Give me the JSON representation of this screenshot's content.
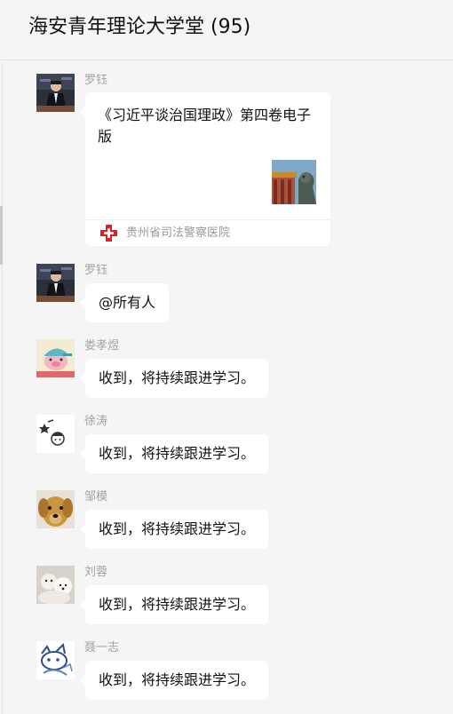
{
  "header": {
    "title": "海安青年理论大学堂 (95)"
  },
  "messages": [
    {
      "sender": "罗钰",
      "type": "link-card",
      "card": {
        "title": "《习近平谈治国理政》第四卷电子版",
        "source": "贵州省司法警察医院",
        "thumbnail": "palace-lion-thumbnail",
        "source_icon": "red-cross-icon"
      }
    },
    {
      "sender": "罗钰",
      "type": "text",
      "text": "@所有人"
    },
    {
      "sender": "娄孝煜",
      "type": "text",
      "text": "收到，将持续跟进学习。"
    },
    {
      "sender": "徐涛",
      "type": "text",
      "text": "收到，将持续跟进学习。"
    },
    {
      "sender": "邹模",
      "type": "text",
      "text": "收到，将持续跟进学习。"
    },
    {
      "sender": "刘蓉",
      "type": "text",
      "text": "收到，将持续跟进学习。"
    },
    {
      "sender": "聂一志",
      "type": "text",
      "text": "收到，将持续跟进学习。"
    }
  ],
  "colors": {
    "background": "#f5f5f5",
    "bubble": "#ffffff",
    "sender_name": "#a3a3a3",
    "card_source_icon": "#e02020"
  }
}
